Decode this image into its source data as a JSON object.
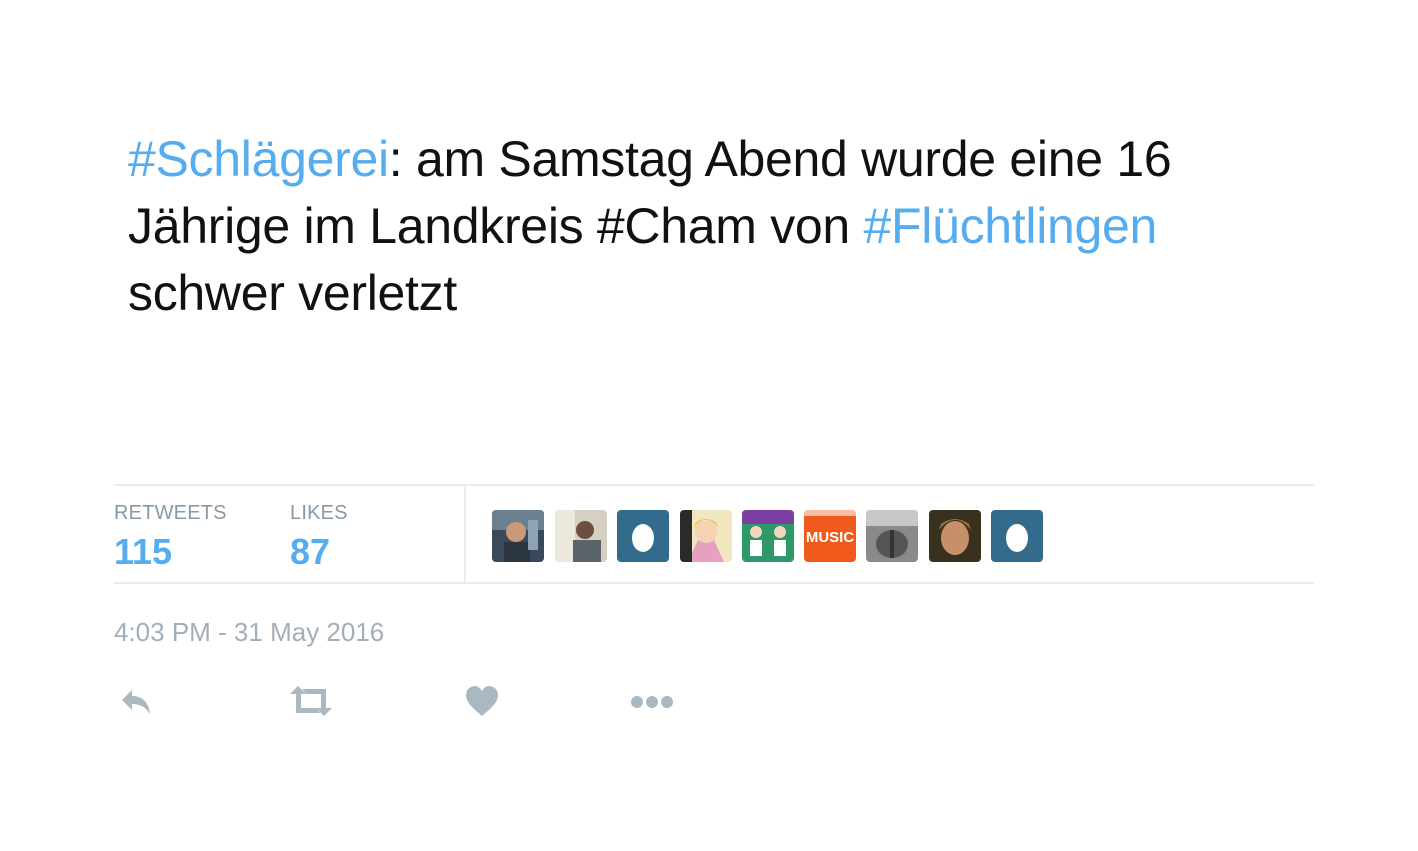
{
  "tweet": {
    "segments": [
      {
        "text": "#Schlägerei",
        "hashtag": true
      },
      {
        "text": ": am Samstag Abend wurde eine 16 Jährige im Landkreis #Cham von ",
        "hashtag": false
      },
      {
        "text": "#Flüchtlingen",
        "hashtag": true
      },
      {
        "text": " schwer verletzt",
        "hashtag": false
      }
    ]
  },
  "stats": {
    "retweets_label": "RETWEETS",
    "retweets_count": "115",
    "likes_label": "LIKES",
    "likes_count": "87"
  },
  "avatars": [
    {
      "name": "avatar-1",
      "style": "photo-dark"
    },
    {
      "name": "avatar-2",
      "style": "photo-light"
    },
    {
      "name": "avatar-3",
      "style": "egg"
    },
    {
      "name": "avatar-4",
      "style": "cartoon"
    },
    {
      "name": "avatar-5",
      "style": "green-pattern"
    },
    {
      "name": "avatar-6",
      "style": "music-logo",
      "text": "MUSIC"
    },
    {
      "name": "avatar-7",
      "style": "photo-gray"
    },
    {
      "name": "avatar-8",
      "style": "photo-face"
    },
    {
      "name": "avatar-9",
      "style": "egg"
    }
  ],
  "timestamp": "4:03 PM - 31 May 2016",
  "actions": [
    {
      "name": "reply",
      "icon": "reply-icon"
    },
    {
      "name": "retweet",
      "icon": "retweet-icon"
    },
    {
      "name": "like",
      "icon": "heart-icon"
    },
    {
      "name": "more",
      "icon": "more-icon"
    }
  ],
  "colors": {
    "link": "#55acee",
    "text": "#111111",
    "muted": "#8899a6",
    "icon": "#aab8c2",
    "egg_bg": "#326b8c"
  }
}
